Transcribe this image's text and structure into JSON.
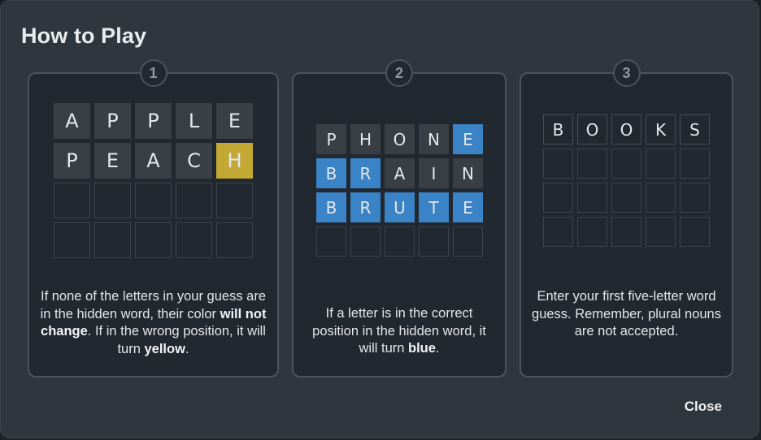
{
  "title": "How to Play",
  "close_label": "Close",
  "colors": {
    "yellow": "#c3a934",
    "blue": "#3a83c6",
    "tile_gray": "#3a3f45",
    "modal_bg": "#2f363d"
  },
  "steps": [
    {
      "number": "1",
      "rows": [
        [
          {
            "l": "A",
            "s": "filled"
          },
          {
            "l": "P",
            "s": "filled"
          },
          {
            "l": "P",
            "s": "filled"
          },
          {
            "l": "L",
            "s": "filled"
          },
          {
            "l": "E",
            "s": "filled"
          }
        ],
        [
          {
            "l": "P",
            "s": "filled"
          },
          {
            "l": "E",
            "s": "filled"
          },
          {
            "l": "A",
            "s": "filled"
          },
          {
            "l": "C",
            "s": "filled"
          },
          {
            "l": "H",
            "s": "yellow"
          }
        ],
        [
          {
            "l": "",
            "s": "empty"
          },
          {
            "l": "",
            "s": "empty"
          },
          {
            "l": "",
            "s": "empty"
          },
          {
            "l": "",
            "s": "empty"
          },
          {
            "l": "",
            "s": "empty"
          }
        ],
        [
          {
            "l": "",
            "s": "empty"
          },
          {
            "l": "",
            "s": "empty"
          },
          {
            "l": "",
            "s": "empty"
          },
          {
            "l": "",
            "s": "empty"
          },
          {
            "l": "",
            "s": "empty"
          }
        ]
      ],
      "text": [
        {
          "t": "If none of the letters in your guess are in the hidden word, their color "
        },
        {
          "t": "will not change",
          "b": true
        },
        {
          "t": ". If in the wrong position, it will turn "
        },
        {
          "t": "yellow",
          "b": true
        },
        {
          "t": "."
        }
      ]
    },
    {
      "number": "2",
      "rows": [
        [
          {
            "l": "P",
            "s": "filled"
          },
          {
            "l": "H",
            "s": "filled"
          },
          {
            "l": "O",
            "s": "filled"
          },
          {
            "l": "N",
            "s": "filled"
          },
          {
            "l": "E",
            "s": "blue"
          }
        ],
        [
          {
            "l": "B",
            "s": "blue"
          },
          {
            "l": "R",
            "s": "blue"
          },
          {
            "l": "A",
            "s": "filled"
          },
          {
            "l": "I",
            "s": "filled"
          },
          {
            "l": "N",
            "s": "filled"
          }
        ],
        [
          {
            "l": "B",
            "s": "blue"
          },
          {
            "l": "R",
            "s": "blue"
          },
          {
            "l": "U",
            "s": "blue"
          },
          {
            "l": "T",
            "s": "blue"
          },
          {
            "l": "E",
            "s": "blue"
          }
        ],
        [
          {
            "l": "",
            "s": "empty"
          },
          {
            "l": "",
            "s": "empty"
          },
          {
            "l": "",
            "s": "empty"
          },
          {
            "l": "",
            "s": "empty"
          },
          {
            "l": "",
            "s": "empty"
          }
        ]
      ],
      "text": [
        {
          "t": "If a letter is in the correct position in the hidden word, it will turn "
        },
        {
          "t": "blue",
          "b": true
        },
        {
          "t": "."
        }
      ]
    },
    {
      "number": "3",
      "rows": [
        [
          {
            "l": "B",
            "s": "outlined"
          },
          {
            "l": "O",
            "s": "outlined"
          },
          {
            "l": "O",
            "s": "outlined"
          },
          {
            "l": "K",
            "s": "outlined"
          },
          {
            "l": "S",
            "s": "outlined"
          }
        ],
        [
          {
            "l": "",
            "s": "empty"
          },
          {
            "l": "",
            "s": "empty"
          },
          {
            "l": "",
            "s": "empty"
          },
          {
            "l": "",
            "s": "empty"
          },
          {
            "l": "",
            "s": "empty"
          }
        ],
        [
          {
            "l": "",
            "s": "empty"
          },
          {
            "l": "",
            "s": "empty"
          },
          {
            "l": "",
            "s": "empty"
          },
          {
            "l": "",
            "s": "empty"
          },
          {
            "l": "",
            "s": "empty"
          }
        ],
        [
          {
            "l": "",
            "s": "empty"
          },
          {
            "l": "",
            "s": "empty"
          },
          {
            "l": "",
            "s": "empty"
          },
          {
            "l": "",
            "s": "empty"
          },
          {
            "l": "",
            "s": "empty"
          }
        ]
      ],
      "text": [
        {
          "t": "Enter your first five-letter word guess. Remember, plural nouns are not accepted."
        }
      ]
    }
  ]
}
